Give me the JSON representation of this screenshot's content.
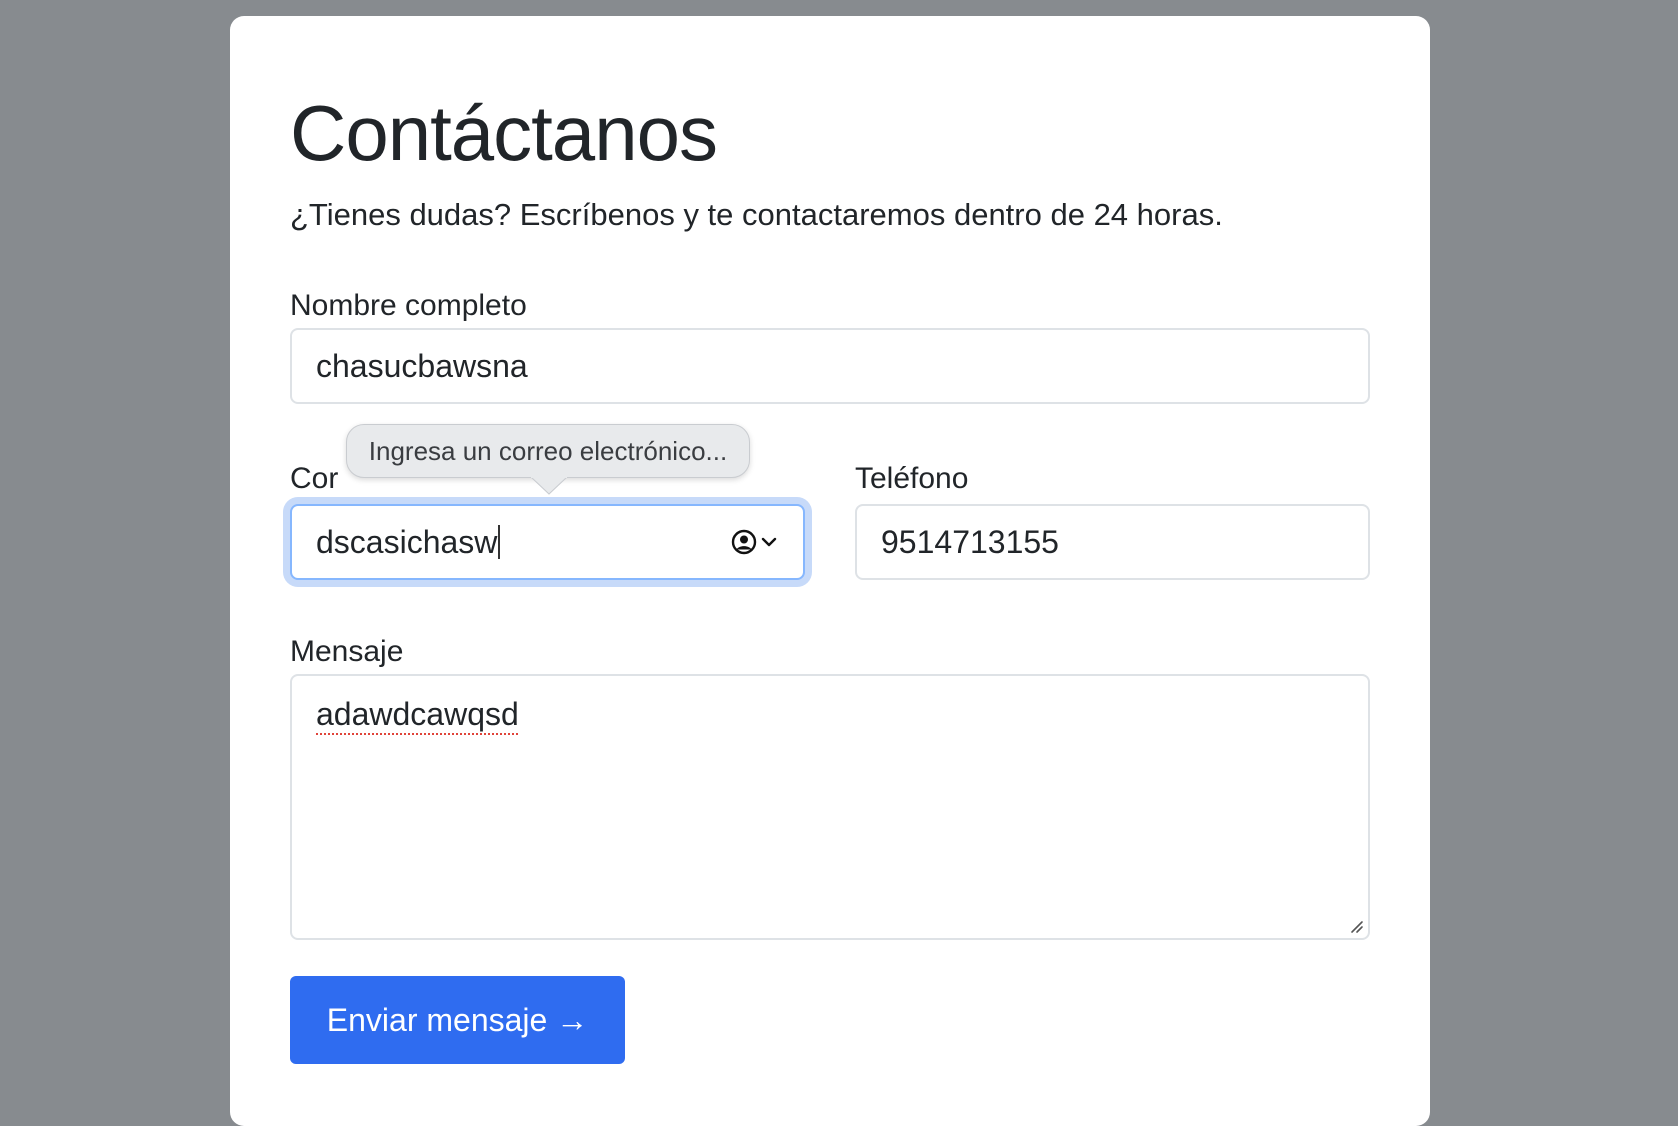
{
  "form": {
    "title": "Contáctanos",
    "subtitle": "¿Tienes dudas? Escríbenos y te contactaremos dentro de 24 horas.",
    "name_label": "Nombre completo",
    "name_value": "chasucbawsna",
    "email_label": "Cor",
    "email_value": "dscasichasw",
    "phone_label": "Teléfono",
    "phone_value": "9514713155",
    "message_label": "Mensaje",
    "message_value": "adawdcawqsd",
    "submit_label": "Enviar mensaje →"
  },
  "validation_tooltip": {
    "text": "Ingresa un correo electrónico..."
  },
  "icons": {
    "autofill": "contact-autofill-icon",
    "chevron": "chevron-down-icon",
    "resize": "resize-handle-icon"
  },
  "colors": {
    "background": "#878b8f",
    "card": "#ffffff",
    "primary": "#2f6cf0",
    "focus_ring": "#86b7fe",
    "spellcheck": "#e0443a"
  }
}
